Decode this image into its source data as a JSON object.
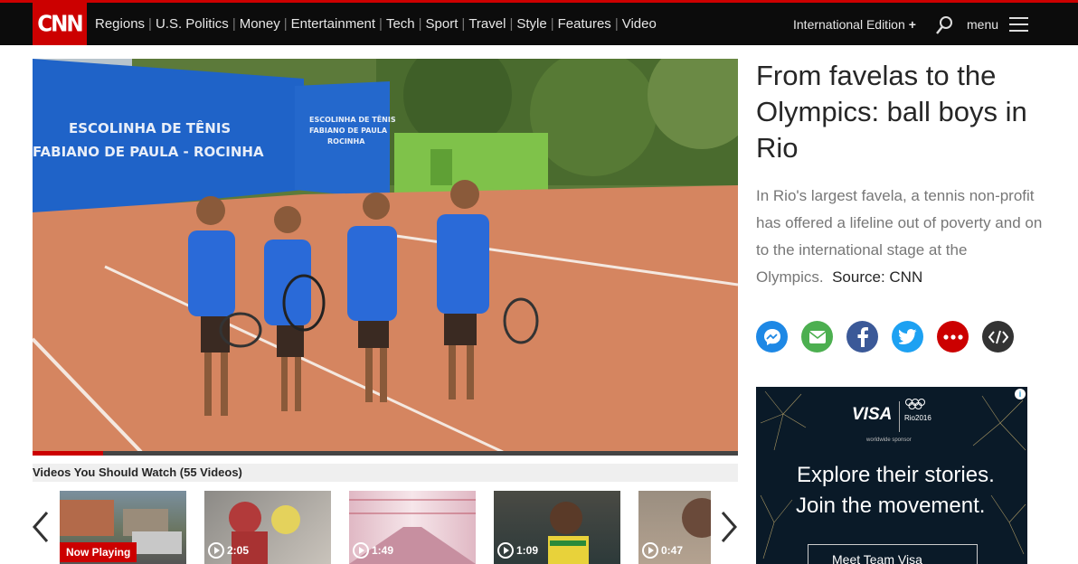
{
  "brand": {
    "logo_text": "CNN",
    "accent": "#cc0000"
  },
  "nav": {
    "items": [
      "Regions",
      "U.S. Politics",
      "Money",
      "Entertainment",
      "Tech",
      "Sport",
      "Travel",
      "Style",
      "Features",
      "Video"
    ],
    "edition_label": "International Edition",
    "edition_plus": "+",
    "menu_label": "menu",
    "search_icon": "search-icon",
    "menu_icon": "hamburger-icon"
  },
  "player": {
    "banner_text_1": "ESCOLINHA DE TÊNIS",
    "banner_text_2": "FABIANO DE PAULA - ROCINHA",
    "banner_text_3": "ESCOLINHA DE TÊNIS",
    "banner_text_4": "FABIANO DE PAULA",
    "banner_text_5": "ROCINHA",
    "progress": 0.1
  },
  "playlist": {
    "title": "Videos You Should Watch (55 Videos)",
    "thumbnails": [
      {
        "label": "Now Playing",
        "now_playing": true
      },
      {
        "duration": "2:05"
      },
      {
        "duration": "1:49"
      },
      {
        "duration": "1:09"
      },
      {
        "duration": "0:47"
      }
    ]
  },
  "article": {
    "headline": "From favelas to the Olympics: ball boys in Rio",
    "description": "In Rio's largest favela, a tennis non-profit has offered a lifeline out of poverty and on to the international stage at the Olympics.",
    "source": "Source: CNN"
  },
  "share": [
    {
      "name": "messenger-icon",
      "color": "#1e88e5"
    },
    {
      "name": "email-icon",
      "color": "#4caf50"
    },
    {
      "name": "facebook-icon",
      "color": "#3b5998"
    },
    {
      "name": "twitter-icon",
      "color": "#1da1f2"
    },
    {
      "name": "more-icon",
      "color": "#cc0000"
    },
    {
      "name": "embed-icon",
      "color": "#333333"
    }
  ],
  "ad": {
    "brand": "VISA",
    "event": "Rio2016",
    "tagline": "worldwide sponsor",
    "line1": "Explore their stories.",
    "line2": "Join the movement.",
    "button": "Meet Team Visa",
    "info_icon": "i"
  }
}
